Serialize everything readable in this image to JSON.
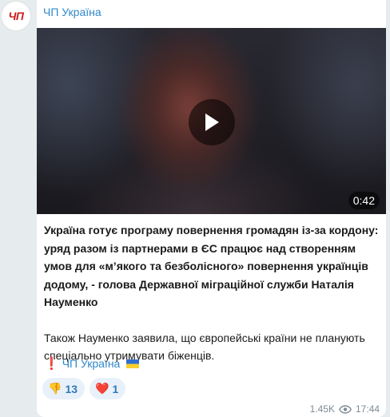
{
  "channel": {
    "avatar_text": "ЧП",
    "name": "ЧП Україна"
  },
  "video": {
    "duration": "0:42"
  },
  "post": {
    "headline": "Україна готує програму повернення громадян із-за кордону: уряд разом із партнерами в ЄС працює над створенням умов для «м’якого та безболісного» повернення українців додому, - голова Державної міграційної служби Наталія Науменко",
    "paragraph": "Також Науменко заявила, що європейські країни не планують спеціально утримувати біженців.",
    "signature_mark": "❗",
    "signature": "ЧП Україна"
  },
  "reactions": [
    {
      "emoji": "👎",
      "count": "13"
    },
    {
      "emoji": "❤️",
      "count": "1"
    }
  ],
  "meta": {
    "views": "1.45K",
    "time": "17:44"
  },
  "colors": {
    "accent": "#2f88c9",
    "background": "#e6ebee",
    "reaction_bg": "#e8f1f9"
  }
}
